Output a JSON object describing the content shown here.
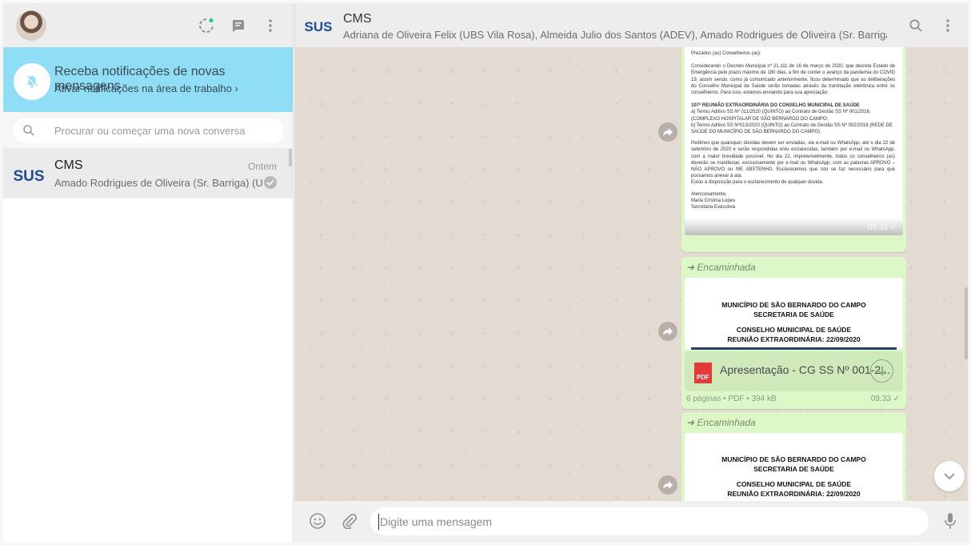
{
  "colors": {
    "sus_blue": "#1e4b97",
    "notification_bg": "#8fdef5",
    "outgoing_bubble": "#dcf8c6",
    "chat_bg": "#e3dbd1",
    "pdf_red": "#e53935"
  },
  "sidebar": {
    "header_icons": [
      "status-icon",
      "new-chat-icon",
      "menu-icon"
    ],
    "notification": {
      "title": "Receba notificações de novas mensagens",
      "link": "Ativar notificações na área de trabalho ›"
    },
    "search": {
      "placeholder": "Procurar ou começar uma nova conversa"
    },
    "chats": [
      {
        "avatar_text": "SUS",
        "name": "CMS",
        "time": "Ontem",
        "preview": "Amado Rodrigues de Oliveira (Sr. Barriga) (UBS Ipê)"
      }
    ]
  },
  "conversation": {
    "avatar_text": "SUS",
    "title": "CMS",
    "members": "Adriana de Oliveira Felix (UBS Vila Rosa), Almeida Julio dos Santos (ADEV), Amado Rodrigues de Oliveira (Sr. Barriga) (UBS Ipê), Anderson Fr...",
    "messages": [
      {
        "type": "image",
        "doc": {
          "greeting": "Prezados (as) Conselheiros (as):",
          "para1": "Considerando o Decreto Municipal nº 21.111 de 16 de março de 2020, que decreta Estado de Emergência pelo prazo máximo de 180 dias, a fim de conter o avanço da pandemia do COVID 19, assim sendo, como já comunicado anteriormente, ficou determinado que as deliberações do Conselho Municipal de Saúde serão tomadas através da tramitação eletrônica entre os conselheiros. Para isso, estamos enviando para sua apreciação:",
          "heading": "107ª REUNIÃO EXTRAORDINÁRIA DO CONSELHO MUNICIPAL DE SAÚDE",
          "item_a": "a)  Termo Aditivo SS Nº 011/2020 (QUINTO) ao Contrato de Gestão SS Nº 001/2018, (COMPLEXO HOSPITALAR DE SÃO BERNARDO DO CAMPO;",
          "item_b": "b)  Termo Aditivo SS Nº013/2020 (QUINTO) ao Contrato de Gestão SS Nº 002/2018 (REDE DE SAÚDE DO MUNICÍPIO DE SÃO BERNARDO DO CAMPO).",
          "para2": "Pedimos que quaisquer dúvidas devem ser enviadas, via e-mail ou WhatsApp, até o dia 22 de setembro de 2020 e serão respondidas e/ou esclarecidas, também por e-mail ou WhatsApp, com a maior brevidade possível. No dia 22, impreterivelmente, todos os conselheiros (as) deverão se manifestar, exclusivamente por e-mail ou WhatsApp, com as palavras APROVO – NÃO APROVO ou ME ABSTENHO. Esclarecemos que isto se faz necessário para que possamos anexar à ata.",
          "para3": "Estou à disposição para o esclarecimento de qualquer dúvida.",
          "closing": "Atenciosamente,",
          "signer": "Maria Cristina Lopes",
          "signer_title": "Secretária Executiva"
        },
        "time": "09:33 ✓"
      },
      {
        "type": "document",
        "forwarded": "Encaminhada",
        "preview_lines": [
          "MUNICÍPIO DE SÃO BERNARDO DO CAMPO",
          "SECRETARIA DE SAÚDE",
          "CONSELHO MUNICIPAL DE SAÚDE",
          "REUNIÃO EXTRAORDINÁRIA: 22/09/2020"
        ],
        "file_name": "Apresentação - CG SS Nº 001-2...",
        "file_icon": "PDF",
        "meta": "6 páginas • PDF • 394 kB",
        "time": "09:33 ✓"
      },
      {
        "type": "document",
        "forwarded": "Encaminhada",
        "preview_lines": [
          "MUNICÍPIO DE SÃO BERNARDO DO CAMPO",
          "SECRETARIA DE SAÚDE",
          "CONSELHO MUNICIPAL DE SAÚDE",
          "REUNIÃO EXTRAORDINÁRIA: 22/09/2020"
        ]
      }
    ]
  },
  "compose": {
    "placeholder": "Digite uma mensagem"
  }
}
